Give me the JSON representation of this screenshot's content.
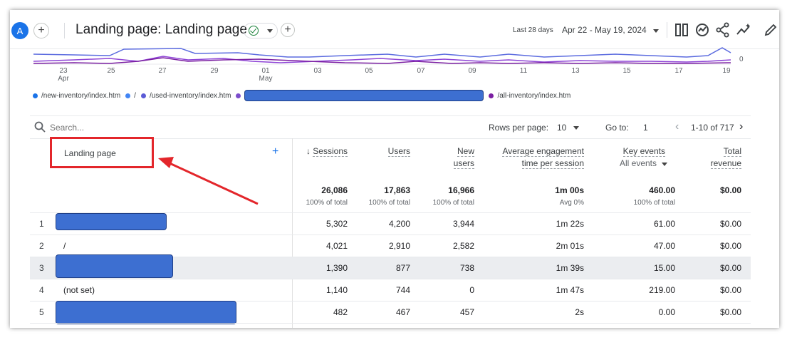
{
  "header": {
    "avatar_letter": "A",
    "title": "Landing page: Landing page",
    "date_prefix": "Last 28 days",
    "date_range": "Apr 22 - May 19, 2024"
  },
  "chart": {
    "x_ticks": [
      "23",
      "25",
      "27",
      "29",
      "01",
      "03",
      "05",
      "07",
      "09",
      "11",
      "13",
      "15",
      "17",
      "19"
    ],
    "x_sub_labels": [
      "Apr",
      "May"
    ],
    "y_tick_right": "0",
    "legend": [
      "/new-inventory/index.htm",
      "/",
      "/used-inventory/index.htm",
      "/all-inventory/index.htm"
    ],
    "colors": {
      "series1": "#1a73e8",
      "series2": "#4285f4",
      "series3": "#5b5bd6",
      "series4": "#7b1fa2"
    }
  },
  "toolbar": {
    "search_placeholder": "Search...",
    "rows_per_page_label": "Rows per page:",
    "rows_per_page_value": "10",
    "goto_label": "Go to:",
    "goto_value": "1",
    "pagination": "1-10 of 717"
  },
  "table": {
    "dimension_header": "Landing page",
    "columns": [
      {
        "label": "Sessions",
        "sorted": true
      },
      {
        "label": "Users"
      },
      {
        "label": "New users",
        "line1": "New",
        "line2": "users"
      },
      {
        "label": "Average engagement time per session",
        "line1": "Average engagement",
        "line2": "time per session"
      },
      {
        "label": "Key events",
        "line1": "Key events",
        "line2": "All events"
      },
      {
        "label": "Total revenue",
        "line1": "Total",
        "line2": "revenue"
      }
    ],
    "totals": [
      "26,086",
      "17,863",
      "16,966",
      "1m 00s",
      "460.00",
      "$0.00"
    ],
    "totals_sub": [
      "100% of total",
      "100% of total",
      "100% of total",
      "Avg 0%",
      "100% of total",
      ""
    ],
    "rows": [
      {
        "idx": "1",
        "name": "",
        "values": [
          "5,302",
          "4,200",
          "3,944",
          "1m 22s",
          "61.00",
          "$0.00"
        ]
      },
      {
        "idx": "2",
        "name": "/",
        "values": [
          "4,021",
          "2,910",
          "2,582",
          "2m 01s",
          "47.00",
          "$0.00"
        ]
      },
      {
        "idx": "3",
        "name": "",
        "values": [
          "1,390",
          "877",
          "738",
          "1m 39s",
          "15.00",
          "$0.00"
        ]
      },
      {
        "idx": "4",
        "name": "(not set)",
        "values": [
          "1,140",
          "744",
          "0",
          "1m 47s",
          "219.00",
          "$0.00"
        ]
      },
      {
        "idx": "5",
        "name": "",
        "values": [
          "482",
          "467",
          "457",
          "2s",
          "0.00",
          "$0.00"
        ]
      }
    ]
  },
  "annotation": {
    "color": "#e3262b"
  }
}
